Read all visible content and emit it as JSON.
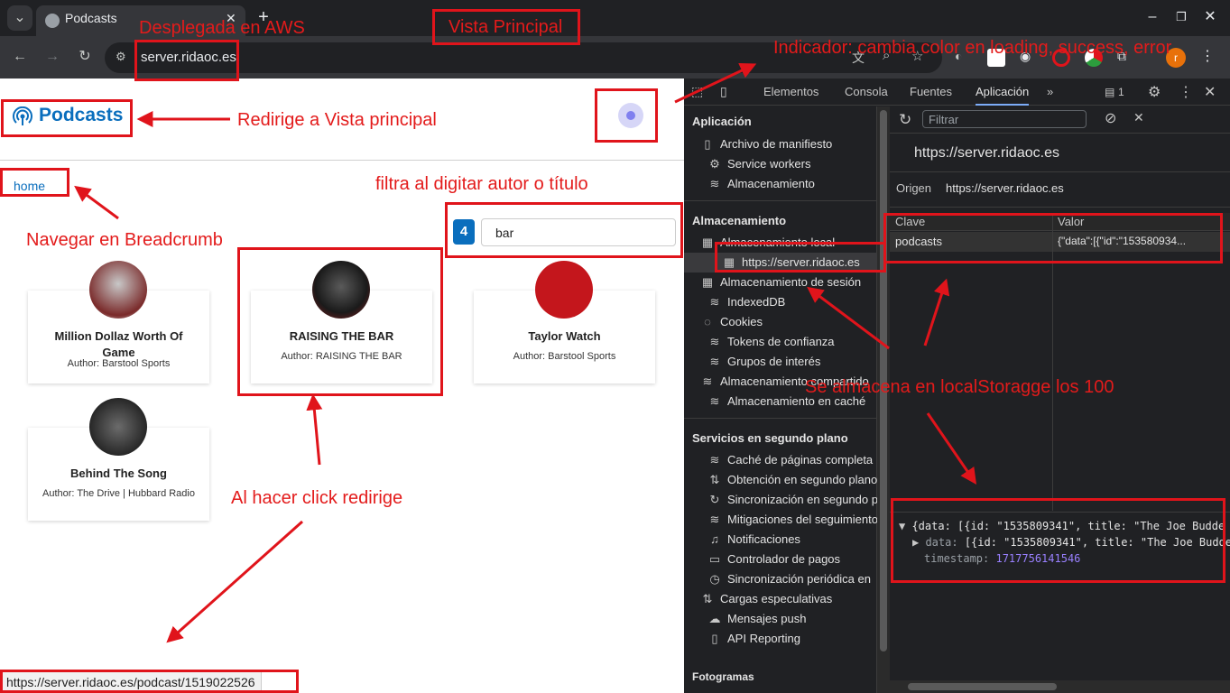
{
  "browser": {
    "tab_title": "Podcasts",
    "url": "server.ridaoc.es",
    "status_url": "https://server.ridaoc.es/podcast/1519022526"
  },
  "app": {
    "title": "Podcasts",
    "breadcrumb": "home",
    "result_count": "4",
    "search_value": "bar",
    "podcasts": [
      {
        "name": "Million Dollaz Worth Of Game",
        "author": "Author: Barstool Sports"
      },
      {
        "name": "RAISING THE BAR",
        "author": "Author: RAISING THE BAR"
      },
      {
        "name": "Taylor Watch",
        "author": "Author: Barstool Sports"
      },
      {
        "name": "Behind The Song",
        "author": "Author: The Drive | Hubbard Radio"
      }
    ]
  },
  "devtools": {
    "tabs": [
      "Elementos",
      "Consola",
      "Fuentes",
      "Aplicación"
    ],
    "issues_count": "1",
    "filter_placeholder": "Filtrar",
    "origin_url": "https://server.ridaoc.es",
    "origin_label": "Origen",
    "origin_value": "https://server.ridaoc.es",
    "sections": {
      "app": "Aplicación",
      "app_items": [
        "Archivo de manifiesto",
        "Service workers",
        "Almacenamiento"
      ],
      "storage": "Almacenamiento",
      "storage_items": [
        "Almacenamiento local",
        "https://server.ridaoc.es",
        "Almacenamiento de sesión",
        "IndexedDB",
        "Cookies",
        "Tokens de confianza",
        "Grupos de interés",
        "Almacenamiento compartido",
        "Almacenamiento en caché"
      ],
      "bg": "Servicios en segundo plano",
      "bg_items": [
        "Caché de páginas completa",
        "Obtención en segundo plano",
        "Sincronización en segundo plano",
        "Mitigaciones del seguimiento",
        "Notificaciones",
        "Controlador de pagos",
        "Sincronización periódica en",
        "Cargas especulativas",
        "Mensajes push",
        "API Reporting"
      ],
      "frames": "Fotogramas"
    },
    "table": {
      "col_key": "Clave",
      "col_value": "Valor",
      "row_key": "podcasts",
      "row_value": "{\"data\":[{\"id\":\"153580934..."
    },
    "preview": {
      "line1": "{data: [{id: \"1535809341\", title: \"The Joe Budde",
      "line2_key": "data:",
      "line2_value": "[{id: \"1535809341\", title: \"The Joe Budde",
      "line3_key": "timestamp:",
      "line3_value": "1717756141546"
    }
  },
  "annotations": {
    "aws": "Desplegada en AWS",
    "main_view": "Vista Principal",
    "indicator": "Indicador: cambia color en loading, success, error",
    "redirect_main": "Redirige a Vista principal",
    "filter": "filtra al digitar autor o título",
    "breadcrumb": "Navegar en Breadcrumb",
    "click": "Al hacer click redirige",
    "storage": "Se almacena en localStoragge los 100"
  },
  "colors": {
    "accent": "#0a6ebd",
    "annotation": "#e31b1b"
  }
}
